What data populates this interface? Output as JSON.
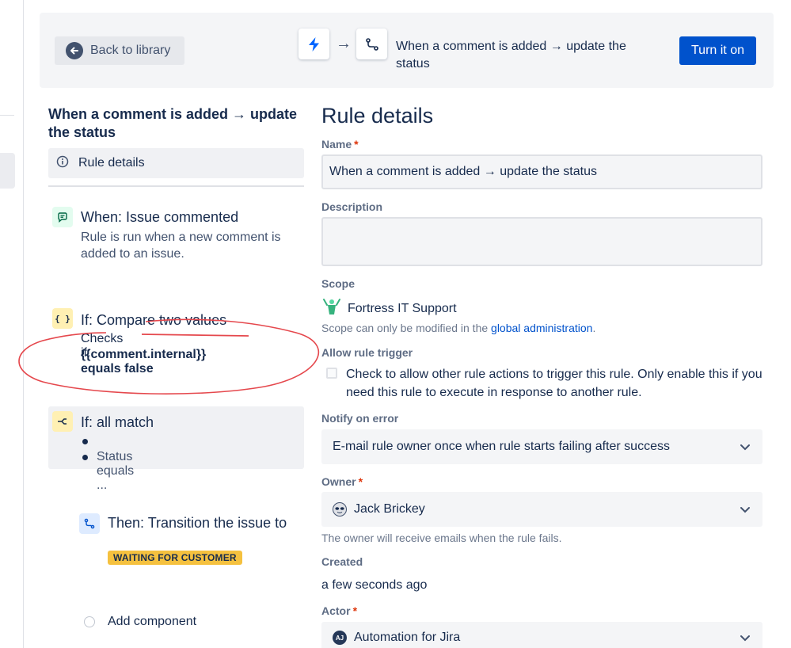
{
  "header": {
    "back_label": "Back to library",
    "rule_title": "When a comment is added → update the status",
    "turn_on_label": "Turn it on"
  },
  "sidebar": {
    "rule_title": "When a comment is added → update the status",
    "rule_details_label": "Rule details",
    "components": [
      {
        "title": "When: Issue commented",
        "description": "Rule is run when a new comment is added to an issue."
      },
      {
        "title": "If: Compare two values",
        "checks_label": "Checks if:",
        "expression": "{{comment.internal}} equals false"
      },
      {
        "title": "If: all match",
        "conditions": [
          "",
          "Status equals ..."
        ]
      },
      {
        "title": "Then: Transition the issue to",
        "status_lozenge": "WAITING FOR CUSTOMER"
      }
    ],
    "add_component_label": "Add component"
  },
  "form": {
    "heading": "Rule details",
    "name_label": "Name",
    "name_value": "When a comment is added → update the status",
    "description_label": "Description",
    "description_value": "",
    "scope_label": "Scope",
    "scope_value": "Fortress IT Support",
    "scope_helper_prefix": "Scope can only be modified in the ",
    "scope_helper_link": "global administration",
    "scope_helper_suffix": ".",
    "allow_trigger_label": "Allow rule trigger",
    "allow_trigger_text": "Check to allow other rule actions to trigger this rule. Only enable this if you need this rule to execute in response to another rule.",
    "allow_trigger_checked": false,
    "notify_label": "Notify on error",
    "notify_value": "E-mail rule owner once when rule starts failing after success",
    "owner_label": "Owner",
    "owner_value": "Jack Brickey",
    "owner_helper": "The owner will receive emails when the rule fails.",
    "created_label": "Created",
    "created_value": "a few seconds ago",
    "actor_label": "Actor",
    "actor_value": "Automation for Jira",
    "actor_initials": "AJ",
    "required_mark": "*"
  },
  "colors": {
    "primary": "#0052cc",
    "lozenge": "#f5c13f",
    "annotation": "#e5484d"
  }
}
